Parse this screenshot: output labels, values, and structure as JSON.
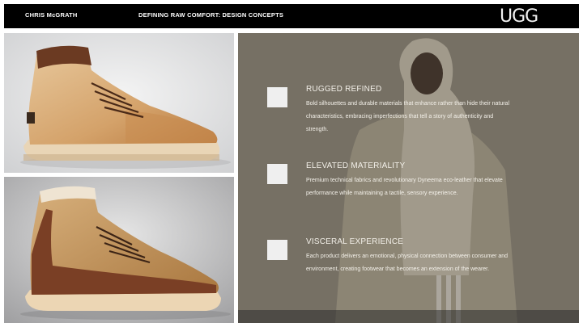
{
  "header": {
    "author": "CHRIS McGRATH",
    "title": "DEFINING RAW COMFORT: DESIGN CONCEPTS",
    "logo": "UGG"
  },
  "concepts": [
    {
      "heading": "RUGGED REFINED",
      "description": "Bold silhouettes and durable materials that enhance rather than hide their natural characteristics, embracing imperfections that tell a story of authenticity and strength."
    },
    {
      "heading": "ELEVATED MATERIALITY",
      "description": "Premium technical fabrics and revolutionary Dyneema eco-leather that elevate performance while maintaining a tactile, sensory experience."
    },
    {
      "heading": "VISCERAL EXPERIENCE",
      "description": "Each product delivers an emotional, physical connection between consumer and environment, creating footwear that becomes an extension of the wearer."
    }
  ]
}
